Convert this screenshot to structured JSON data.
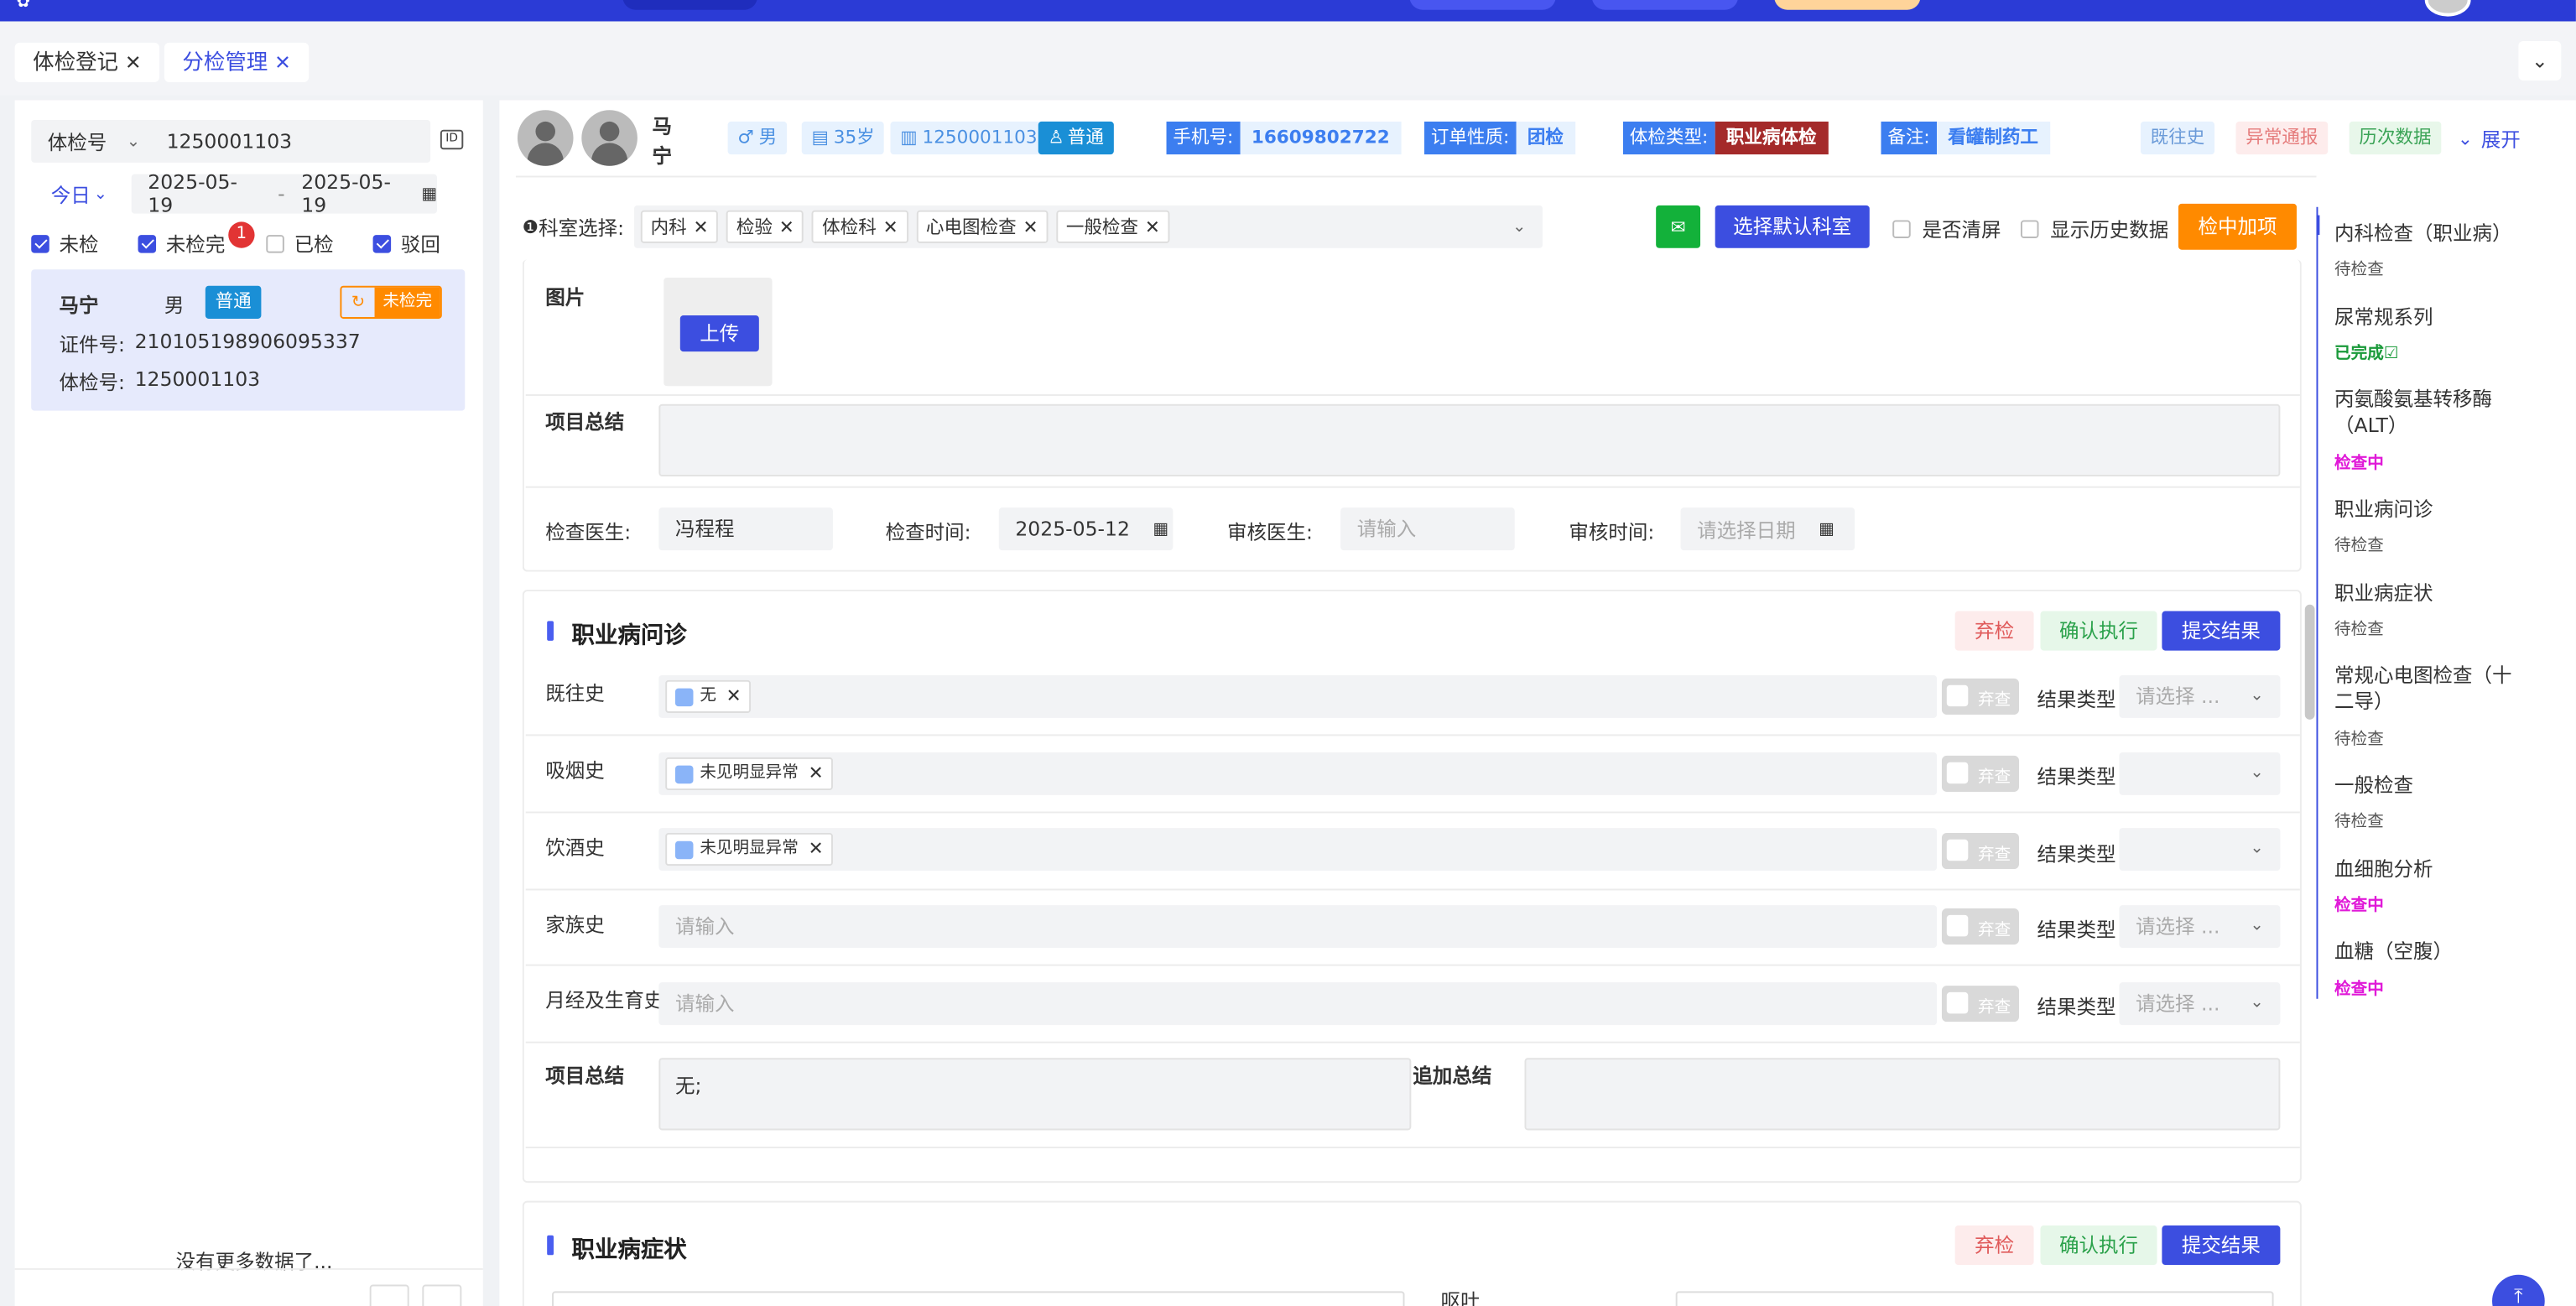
{
  "tabs": [
    {
      "label": "体检登记",
      "close": "✕"
    },
    {
      "label": "分检管理",
      "close": "✕"
    }
  ],
  "search": {
    "type_label": "体检号",
    "value": "1250001103",
    "date_preset": "今日",
    "date_from": "2025-05-19",
    "date_sep": "-",
    "date_to": "2025-05-19"
  },
  "filters": [
    {
      "label": "未检",
      "checked": true
    },
    {
      "label": "未检完",
      "checked": true,
      "badge": "1"
    },
    {
      "label": "已检",
      "checked": false
    },
    {
      "label": "驳回",
      "checked": true
    }
  ],
  "patient_card": {
    "name": "马宁",
    "gender": "男",
    "level": "普通",
    "status": "未检完",
    "id_label": "证件号:",
    "id_value": "210105198906095337",
    "no_label": "体检号:",
    "no_value": "1250001103"
  },
  "list_footer": "没有更多数据了...",
  "header": {
    "name_line1": "马",
    "name_line2": "宁",
    "gender": "男",
    "age": "35岁",
    "exam_no": "1250001103",
    "level": "普通",
    "phone_label": "手机号:",
    "phone": "16609802722",
    "order_label": "订单性质:",
    "order": "团检",
    "type_label": "体检类型:",
    "type": "职业病体检",
    "remark_label": "备注:",
    "remark": "看罐制药工",
    "history_btn": "既往史",
    "abnormal_btn": "异常通报",
    "past_btn": "历次数据",
    "expand": "展开"
  },
  "dept": {
    "label": "科室选择:",
    "chips": [
      "内科",
      "检验",
      "体检科",
      "心电图检查",
      "一般检查"
    ],
    "default_btn": "选择默认科室",
    "clear_label": "是否清屏",
    "history_label": "显示历史数据",
    "add_btn": "检中加项"
  },
  "image_section": {
    "label": "图片",
    "upload": "上传",
    "summary_label": "项目总结",
    "doctor_label": "检查医生:",
    "doctor": "冯程程",
    "time_label": "检查时间:",
    "time": "2025-05-12",
    "review_label": "审核医生:",
    "review_ph": "请输入",
    "review_time_label": "审核时间:",
    "review_time_ph": "请选择日期"
  },
  "inquiry": {
    "title": "职业病问诊",
    "abandon": "弃检",
    "confirm": "确认执行",
    "submit": "提交结果",
    "rows": [
      {
        "label": "既往史",
        "tag": "无",
        "placeholder": "",
        "sel": "请选择 ..."
      },
      {
        "label": "吸烟史",
        "tag": "未见明显异常",
        "placeholder": "",
        "sel": ""
      },
      {
        "label": "饮酒史",
        "tag": "未见明显异常",
        "placeholder": "",
        "sel": ""
      },
      {
        "label": "家族史",
        "tag": "",
        "placeholder": "请输入",
        "sel": "请选择 ..."
      },
      {
        "label": "月经及生育史",
        "tag": "",
        "placeholder": "请输入",
        "sel": "请选择 ..."
      }
    ],
    "toggle_label": "弃查",
    "result_type_label": "结果类型",
    "summary_label": "项目总结",
    "summary": "无;",
    "extra_label": "追加总结"
  },
  "symptoms": {
    "title": "职业病症状",
    "abandon": "弃检",
    "confirm": "确认执行",
    "submit": "提交结果",
    "partial_right": "呕吐"
  },
  "right_items": [
    {
      "name": "内科检查（职业病）",
      "status": "待检查",
      "color": "#555"
    },
    {
      "name": "尿常规系列",
      "status": "已完成☑",
      "color": "#1a9a3a"
    },
    {
      "name": "丙氨酸氨基转移酶（ALT）",
      "status": "检查中",
      "color": "#e01ad8"
    },
    {
      "name": "职业病问诊",
      "status": "待检查",
      "color": "#555"
    },
    {
      "name": "职业病症状",
      "status": "待检查",
      "color": "#555"
    },
    {
      "name": "常规心电图检查（十二导）",
      "status": "待检查",
      "color": "#555"
    },
    {
      "name": "一般检查",
      "status": "待检查",
      "color": "#555"
    },
    {
      "name": "血细胞分析",
      "status": "检查中",
      "color": "#e01ad8"
    },
    {
      "name": "血糖（空腹）",
      "status": "检查中",
      "color": "#e01ad8"
    }
  ],
  "colors": {
    "primary": "#3c4ee0",
    "orange": "#ff8a00",
    "red": "#a42a2a",
    "green_btn": "#13b13a"
  }
}
